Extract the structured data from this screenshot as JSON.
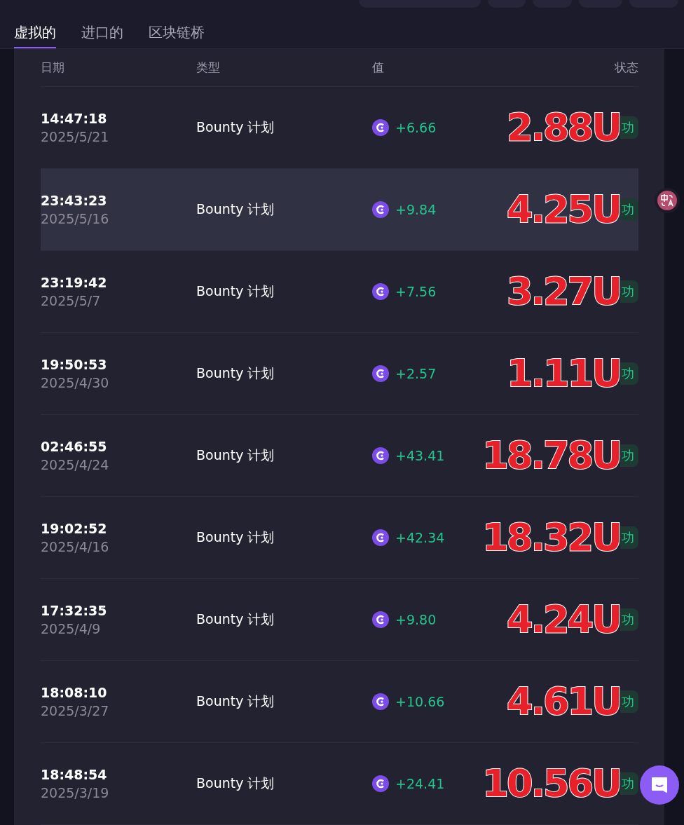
{
  "tabs": [
    {
      "label": "虚拟的",
      "selected": true
    },
    {
      "label": "进口的",
      "selected": false
    },
    {
      "label": "区块链桥",
      "selected": false
    }
  ],
  "table": {
    "columns": [
      "日期",
      "类型",
      "值",
      "状态"
    ],
    "rows": [
      {
        "time": "14:47:18",
        "date": "2025/5/21",
        "type": "Bounty 计划",
        "value": "+6.66",
        "status": "功",
        "note": "2.88U",
        "selected": false
      },
      {
        "time": "23:43:23",
        "date": "2025/5/16",
        "type": "Bounty 计划",
        "value": "+9.84",
        "status": "功",
        "note": "4.25U",
        "selected": true
      },
      {
        "time": "23:19:42",
        "date": "2025/5/7",
        "type": "Bounty 计划",
        "value": "+7.56",
        "status": "功",
        "note": "3.27U",
        "selected": false
      },
      {
        "time": "19:50:53",
        "date": "2025/4/30",
        "type": "Bounty 计划",
        "value": "+2.57",
        "status": "功",
        "note": "1.11U",
        "selected": false
      },
      {
        "time": "02:46:55",
        "date": "2025/4/24",
        "type": "Bounty 计划",
        "value": "+43.41",
        "status": "功",
        "note": "18.78U",
        "selected": false
      },
      {
        "time": "19:02:52",
        "date": "2025/4/16",
        "type": "Bounty 计划",
        "value": "+42.34",
        "status": "功",
        "note": "18.32U",
        "selected": false
      },
      {
        "time": "17:32:35",
        "date": "2025/4/9",
        "type": "Bounty 计划",
        "value": "+9.80",
        "status": "功",
        "note": "4.24U",
        "selected": false
      },
      {
        "time": "18:08:10",
        "date": "2025/3/27",
        "type": "Bounty 计划",
        "value": "+10.66",
        "status": "功",
        "note": "4.61U",
        "selected": false
      },
      {
        "time": "18:48:54",
        "date": "2025/3/19",
        "type": "Bounty 计划",
        "value": "+24.41",
        "status": "功",
        "note": "10.56U",
        "selected": false
      }
    ]
  }
}
